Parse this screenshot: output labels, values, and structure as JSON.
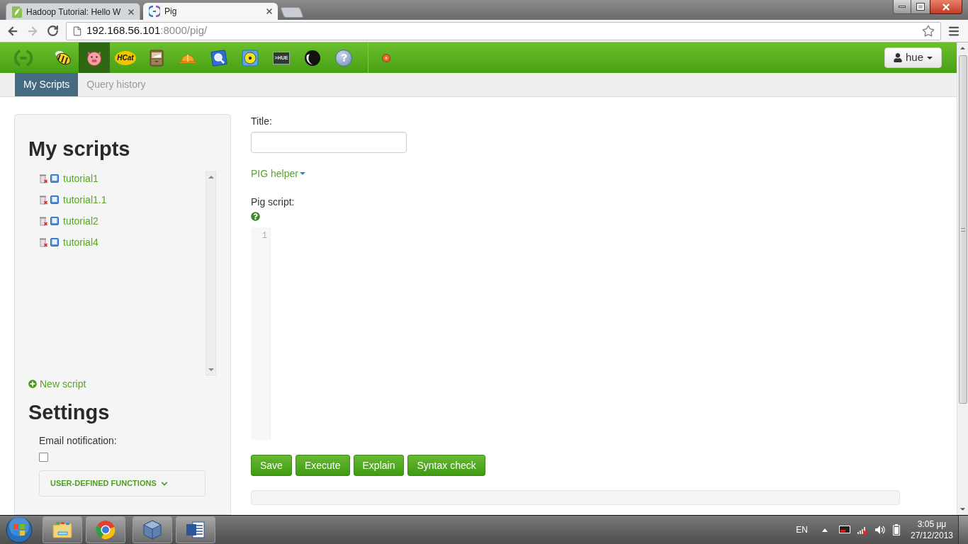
{
  "browser": {
    "tabs": [
      {
        "title": "Hadoop Tutorial: Hello W",
        "kind": "leaf",
        "selected": false
      },
      {
        "title": "Pig",
        "kind": "logo",
        "selected": true
      }
    ],
    "back": {
      "disabled": false
    },
    "forward": {
      "disabled": true
    },
    "address_bar": {
      "host": "192.168.56.101",
      "path": ":8000/pig/"
    }
  },
  "app_bar": {
    "apps": [
      {
        "kind": "bee",
        "selected": false
      },
      {
        "kind": "pig",
        "selected": true
      },
      {
        "kind": "hcat",
        "text": "HCat",
        "selected": false
      },
      {
        "kind": "cabinet",
        "selected": false
      },
      {
        "kind": "hardhat",
        "selected": false
      },
      {
        "kind": "magnifier",
        "selected": false
      },
      {
        "kind": "target",
        "selected": false
      },
      {
        "kind": "terminal",
        "text": ">HUE",
        "selected": false
      },
      {
        "kind": "sphere",
        "selected": false
      },
      {
        "kind": "help",
        "selected": false
      }
    ],
    "user_menu": {
      "label": "hue"
    }
  },
  "subnav": {
    "tabs": [
      {
        "label": "My Scripts",
        "selected": true
      },
      {
        "label": "Query history",
        "selected": false
      }
    ]
  },
  "sidebar": {
    "title": "My scripts",
    "scripts": [
      {
        "name": "tutorial1"
      },
      {
        "name": "tutorial1.1"
      },
      {
        "name": "tutorial2"
      },
      {
        "name": "tutorial4"
      }
    ],
    "new_script": "New script",
    "settings": {
      "title": "Settings",
      "email_notification": {
        "label": "Email notification:",
        "checked": false
      },
      "udf": {
        "label": "USER-DEFINED FUNCTIONS",
        "expanded": false
      }
    }
  },
  "editor": {
    "title_field": {
      "label": "Title:"
    },
    "helper": {
      "label": "PIG helper"
    },
    "script": {
      "label": "Pig script:",
      "line_numbers": [
        "1"
      ]
    },
    "buttons": [
      "Save",
      "Execute",
      "Explain",
      "Syntax check"
    ]
  },
  "taskbar": {
    "pinned": [
      {
        "kind": "folder"
      },
      {
        "kind": "ring"
      },
      {
        "kind": "cube"
      },
      {
        "kind": "doc"
      }
    ],
    "tray": {
      "language": "EN",
      "time": "3:05 μμ",
      "date": "27/12/2013"
    }
  }
}
